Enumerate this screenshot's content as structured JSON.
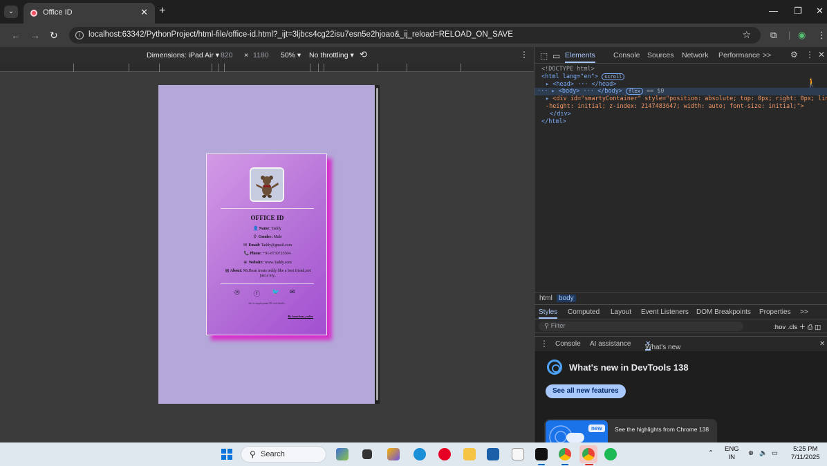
{
  "browser": {
    "tab_title": "Office ID",
    "new_tab": "+",
    "url": "localhost:63342/PythonProject/html-file/office-id.html?_ijt=3ljbcs4cg22isu7esn5e2hjoao&_ij_reload=RELOAD_ON_SAVE"
  },
  "device_toolbar": {
    "dimensions_label": "Dimensions: iPad Air",
    "width": "820",
    "times": "×",
    "height": "1180",
    "zoom": "50%",
    "throttling": "No throttling"
  },
  "card": {
    "title": "OFFICE ID",
    "fields": [
      {
        "icon": "person-icon",
        "glyph": "👤",
        "label": "Name:",
        "value": "Taddy"
      },
      {
        "icon": "gender-icon",
        "glyph": "♀",
        "label": "Gender:",
        "value": "Male"
      },
      {
        "icon": "email-icon",
        "glyph": "✉",
        "label": "Email:",
        "value": "Taddy@gmail.com"
      },
      {
        "icon": "phone-icon",
        "glyph": "📞",
        "label": "Phone:",
        "value": "+91-8739725504"
      },
      {
        "icon": "globe-icon",
        "glyph": "⊕",
        "label": "Website:",
        "value": "www.Taddy.com"
      }
    ],
    "about_label": "About:",
    "about_value": "Mr.Bean treats teddy like a best friend,not just a toy..",
    "footnote": "this is employment ID card details..",
    "byline": "By kanchan_yadav"
  },
  "devtools": {
    "tabs": [
      "Elements",
      "Console",
      "Sources",
      "Network",
      "Performance"
    ],
    "more": ">>",
    "dom": {
      "doctype": "<!DOCTYPE html>",
      "html_open": "<html lang=\"en\">",
      "scroll_badge": "scroll",
      "head": "<head> ··· </head>",
      "body": "<body> ··· </body>",
      "flex_badge": "flex",
      "eq_var": "== $0",
      "div_line1": "<div id=\"smartyContainer\" style=\"position: absolute; top: 0px; right: 0px; lin",
      "div_line2": "-height: initial; z-index: 2147483647; width: auto; font-size: initial;\">",
      "div_close": "</div>",
      "html_close": "</html>"
    },
    "breadcrumbs": [
      "html",
      "body"
    ],
    "styles_tabs": [
      "Styles",
      "Computed",
      "Layout",
      "Event Listeners",
      "DOM Breakpoints",
      "Properties"
    ],
    "filter_placeholder": "Filter",
    "filter_tools": ":hov  .cls",
    "drawer_tabs": [
      "Console",
      "AI assistance",
      "What's new"
    ],
    "whats_new_title": "What's new in DevTools 138",
    "see_all": "See all new features",
    "highlight_badge": "new",
    "highlight_text": "See the highlights from Chrome 138"
  },
  "taskbar": {
    "search": "Search",
    "lang_top": "ENG",
    "lang_bottom": "IN",
    "time": "5:25 PM",
    "date": "7/11/2025"
  }
}
